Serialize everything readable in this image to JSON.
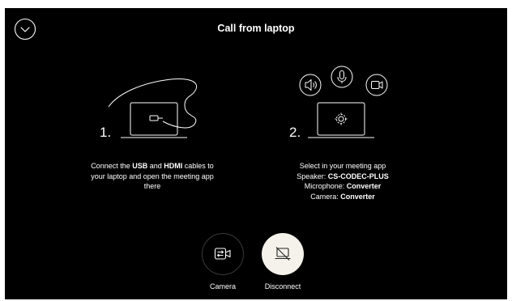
{
  "header": {
    "title": "Call from laptop"
  },
  "step1": {
    "number": "1.",
    "line1_pre": "Connect the ",
    "line1_usb": "USB",
    "line1_mid": " and ",
    "line1_hdmi": "HDMI",
    "line1_post": " cables to",
    "line2": "your laptop and open the meeting app",
    "line3": "there"
  },
  "step2": {
    "number": "2.",
    "line1": "Select in your meeting app",
    "speaker_label": "Speaker: ",
    "speaker_value": "CS-CODEC-PLUS",
    "microphone_label": "Microphone: ",
    "microphone_value": "Converter",
    "camera_label": "Camera: ",
    "camera_value": "Converter"
  },
  "controls": {
    "camera_label": "Camera",
    "disconnect_label": "Disconnect"
  },
  "colors": {
    "background": "#000000",
    "text": "#ffffff",
    "disconnect_bg": "#f4f2ea"
  },
  "icons": {
    "collapse": "chevron-down-circle-icon",
    "speaker": "speaker-icon",
    "microphone": "microphone-icon",
    "camera": "video-camera-icon",
    "settings": "gear-icon",
    "camera_button": "camera-switch-icon",
    "disconnect_button": "laptop-disconnect-icon"
  }
}
